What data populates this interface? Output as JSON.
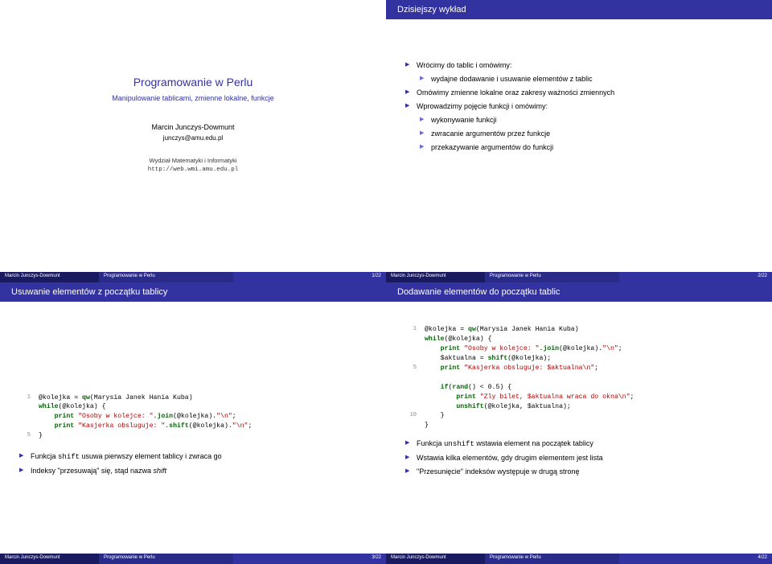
{
  "slide1": {
    "title": "Programowanie w Perlu",
    "subtitle": "Manipulowanie tablicami, zmienne lokalne, funkcje",
    "author": "Marcin Junczys-Dowmunt",
    "email": "junczys@amu.edu.pl",
    "affil1": "Wydział Matematyki i Informatyki",
    "affil2": "http://web.wmi.amu.edu.pl",
    "footer_author": "Marcin Junczys-Dowmunt",
    "footer_title": "Programowanie w Perlu",
    "footer_page": "1/22"
  },
  "slide2": {
    "titlebar": "Dzisiejszy wykład",
    "b1": "Wrócimy do tablic i omówimy:",
    "b1a": "wydajne dodawanie i usuwanie elementów z tablic",
    "b2": "Omówimy zmienne lokalne oraz zakresy ważności zmiennych",
    "b3": "Wprowadzimy pojęcie funkcji i omówimy:",
    "b3a": "wykonywanie funkcji",
    "b3b": "zwracanie argumentów przez funkcje",
    "b3c": "przekazywanie argumentów do funkcji",
    "footer_author": "Marcin Junczys-Dowmunt",
    "footer_title": "Programowanie w Perlu",
    "footer_page": "2/22"
  },
  "slide3": {
    "titlebar": "Usuwanie elementów z początku tablicy",
    "code_l1a": "@kolejka = ",
    "code_l1b": "qw",
    "code_l1c": "(Marysia Janek Hania Kuba)",
    "code_l2a": "while",
    "code_l2b": "(@kolejka) {",
    "code_l3a": "    ",
    "code_l3b": "print",
    "code_l3c": " \"Osoby w kolejce: \"",
    "code_l3d": ".",
    "code_l3e": "join",
    "code_l3f": "(@kolejka).",
    "code_l3g": "\"\\n\"",
    "code_l3h": ";",
    "code_l4a": "    ",
    "code_l4b": "print",
    "code_l4c": " \"Kasjerka obsluguje: \"",
    "code_l4d": ".",
    "code_l4e": "shift",
    "code_l4f": "(@kolejka).",
    "code_l4g": "\"\\n\"",
    "code_l4h": ";",
    "code_l5": "}",
    "b1a": "Funkcja ",
    "b1b": "shift",
    "b1c": " usuwa pierwszy element tablicy i zwraca go",
    "b2a": "Indeksy \"przesuwają\" się, stąd nazwa ",
    "b2b": "shift",
    "footer_author": "Marcin Junczys-Dowmunt",
    "footer_title": "Programowanie w Perlu",
    "footer_page": "3/22"
  },
  "slide4": {
    "titlebar": "Dodawanie elementów do początku tablic",
    "c1a": "@kolejka = ",
    "c1b": "qw",
    "c1c": "(Marysia Janek Hania Kuba)",
    "c2a": "while",
    "c2b": "(@kolejka) {",
    "c3a": "    ",
    "c3b": "print",
    "c3c": " \"Osoby w kolejce: \"",
    "c3d": ".",
    "c3e": "join",
    "c3f": "(@kolejka).",
    "c3g": "\"\\n\"",
    "c3h": ";",
    "c4a": "    $aktualna = ",
    "c4b": "shift",
    "c4c": "(@kolejka);",
    "c5a": "    ",
    "c5b": "print",
    "c5c": " \"Kasjerka obsluguje: $aktualna\\n\"",
    "c5d": ";",
    "c6": "",
    "c7a": "    ",
    "c7b": "if",
    "c7c": "(",
    "c7d": "rand",
    "c7e": "() < 0.5) {",
    "c8a": "        ",
    "c8b": "print",
    "c8c": " \"Zly bilet, $aktualna wraca do okna\\n\"",
    "c8d": ";",
    "c9a": "        ",
    "c9b": "unshift",
    "c9c": "(@kolejka, $aktualna);",
    "c10": "    }",
    "c11": "}",
    "b1a": "Funkcja ",
    "b1b": "unshift",
    "b1c": " wstawia element na początek tablicy",
    "b2": "Wstawia kilka elementów, gdy drugim elementem jest lista",
    "b3": "\"Przesunięcie\" indeksów występuje w drugą stronę",
    "footer_author": "Marcin Junczys-Dowmunt",
    "footer_title": "Programowanie w Perlu",
    "footer_page": "4/22"
  }
}
